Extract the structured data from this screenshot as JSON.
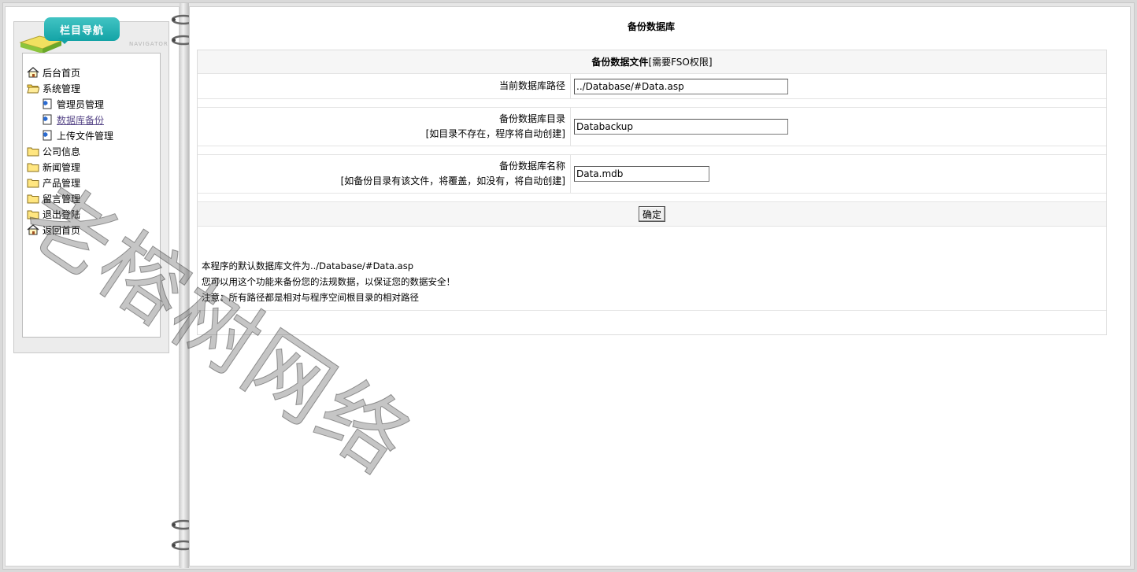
{
  "nav": {
    "title": "栏目导航",
    "title_sub": "NAVIGATOR",
    "items": [
      {
        "label": "后台首页",
        "icon": "home-icon",
        "level": 0
      },
      {
        "label": "系统管理",
        "icon": "folder-open-icon",
        "level": 0
      },
      {
        "label": "管理员管理",
        "icon": "document-icon",
        "level": 1
      },
      {
        "label": "数据库备份",
        "icon": "document-icon",
        "level": 1,
        "active": true
      },
      {
        "label": "上传文件管理",
        "icon": "document-icon",
        "level": 1
      },
      {
        "label": "公司信息",
        "icon": "folder-icon",
        "level": 0
      },
      {
        "label": "新闻管理",
        "icon": "folder-icon",
        "level": 0
      },
      {
        "label": "产品管理",
        "icon": "folder-icon",
        "level": 0
      },
      {
        "label": "留言管理",
        "icon": "folder-icon",
        "level": 0
      },
      {
        "label": "退出登陆",
        "icon": "folder-icon",
        "level": 0
      },
      {
        "label": "返回首页",
        "icon": "home-icon",
        "level": 0
      }
    ]
  },
  "main": {
    "page_title": "备份数据库",
    "section_title": "备份数据文件",
    "section_note": "[需要FSO权限]",
    "fields": {
      "current_path": {
        "label": "当前数据库路径",
        "value": "../Database/#Data.asp"
      },
      "backup_dir": {
        "label": "备份数据库目录",
        "hint": "[如目录不存在，程序将自动创建]",
        "value": "Databackup"
      },
      "backup_name": {
        "label": "备份数据库名称",
        "hint": "[如备份目录有该文件，将覆盖，如没有，将自动创建]",
        "value": "Data.mdb"
      }
    },
    "submit_label": "确定",
    "notes": [
      "本程序的默认数据库文件为../Database/#Data.asp",
      "您可以用这个功能来备份您的法规数据，以保证您的数据安全！",
      "注意：所有路径都是相对与程序空间根目录的相对路径"
    ]
  },
  "watermark": "老榕树网络",
  "colors": {
    "nav_tab": "#13a3a6",
    "page_bg": "#ffffff",
    "frame_bg": "#e6e6e6"
  }
}
